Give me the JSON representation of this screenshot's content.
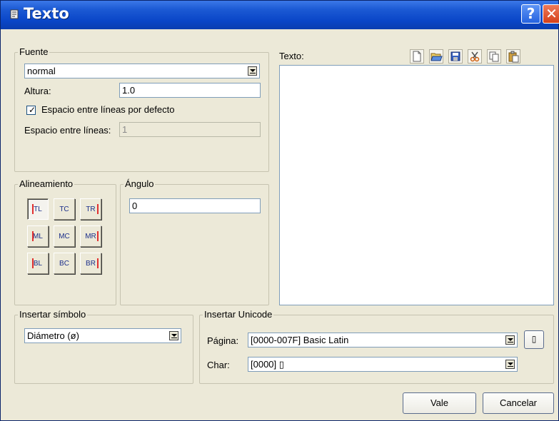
{
  "window": {
    "title": "Texto"
  },
  "font_group": {
    "legend": "Fuente",
    "font_value": "normal",
    "height_label": "Altura:",
    "height_value": "1.0",
    "default_spacing_checked": true,
    "default_spacing_label": "Espacio entre líneas por defecto",
    "spacing_label": "Espacio entre líneas:",
    "spacing_value": "1"
  },
  "text_section": {
    "label": "Texto:"
  },
  "toolbar": {
    "icons": [
      "new-file-icon",
      "open-folder-icon",
      "save-icon",
      "cut-icon",
      "copy-icon",
      "paste-icon"
    ]
  },
  "alignment": {
    "legend": "Alineamiento",
    "buttons": [
      "TL",
      "TC",
      "TR",
      "ML",
      "MC",
      "MR",
      "BL",
      "BC",
      "BR"
    ],
    "selected": "TL"
  },
  "angle": {
    "legend": "Ángulo",
    "value": "0"
  },
  "symbol": {
    "legend": "Insertar símbolo",
    "value": "Diámetro (ø)"
  },
  "unicode": {
    "legend": "Insertar Unicode",
    "page_label": "Página:",
    "page_value": "[0000-007F] Basic Latin",
    "char_label": "Char:",
    "char_value": "[0000] ▯",
    "insert_glyph": "▯"
  },
  "buttons": {
    "ok": "Vale",
    "cancel": "Cancelar"
  },
  "colors": {
    "title_bar": "#0a46c8",
    "window_bg": "#ece9d8",
    "field_border": "#7f9db9"
  }
}
